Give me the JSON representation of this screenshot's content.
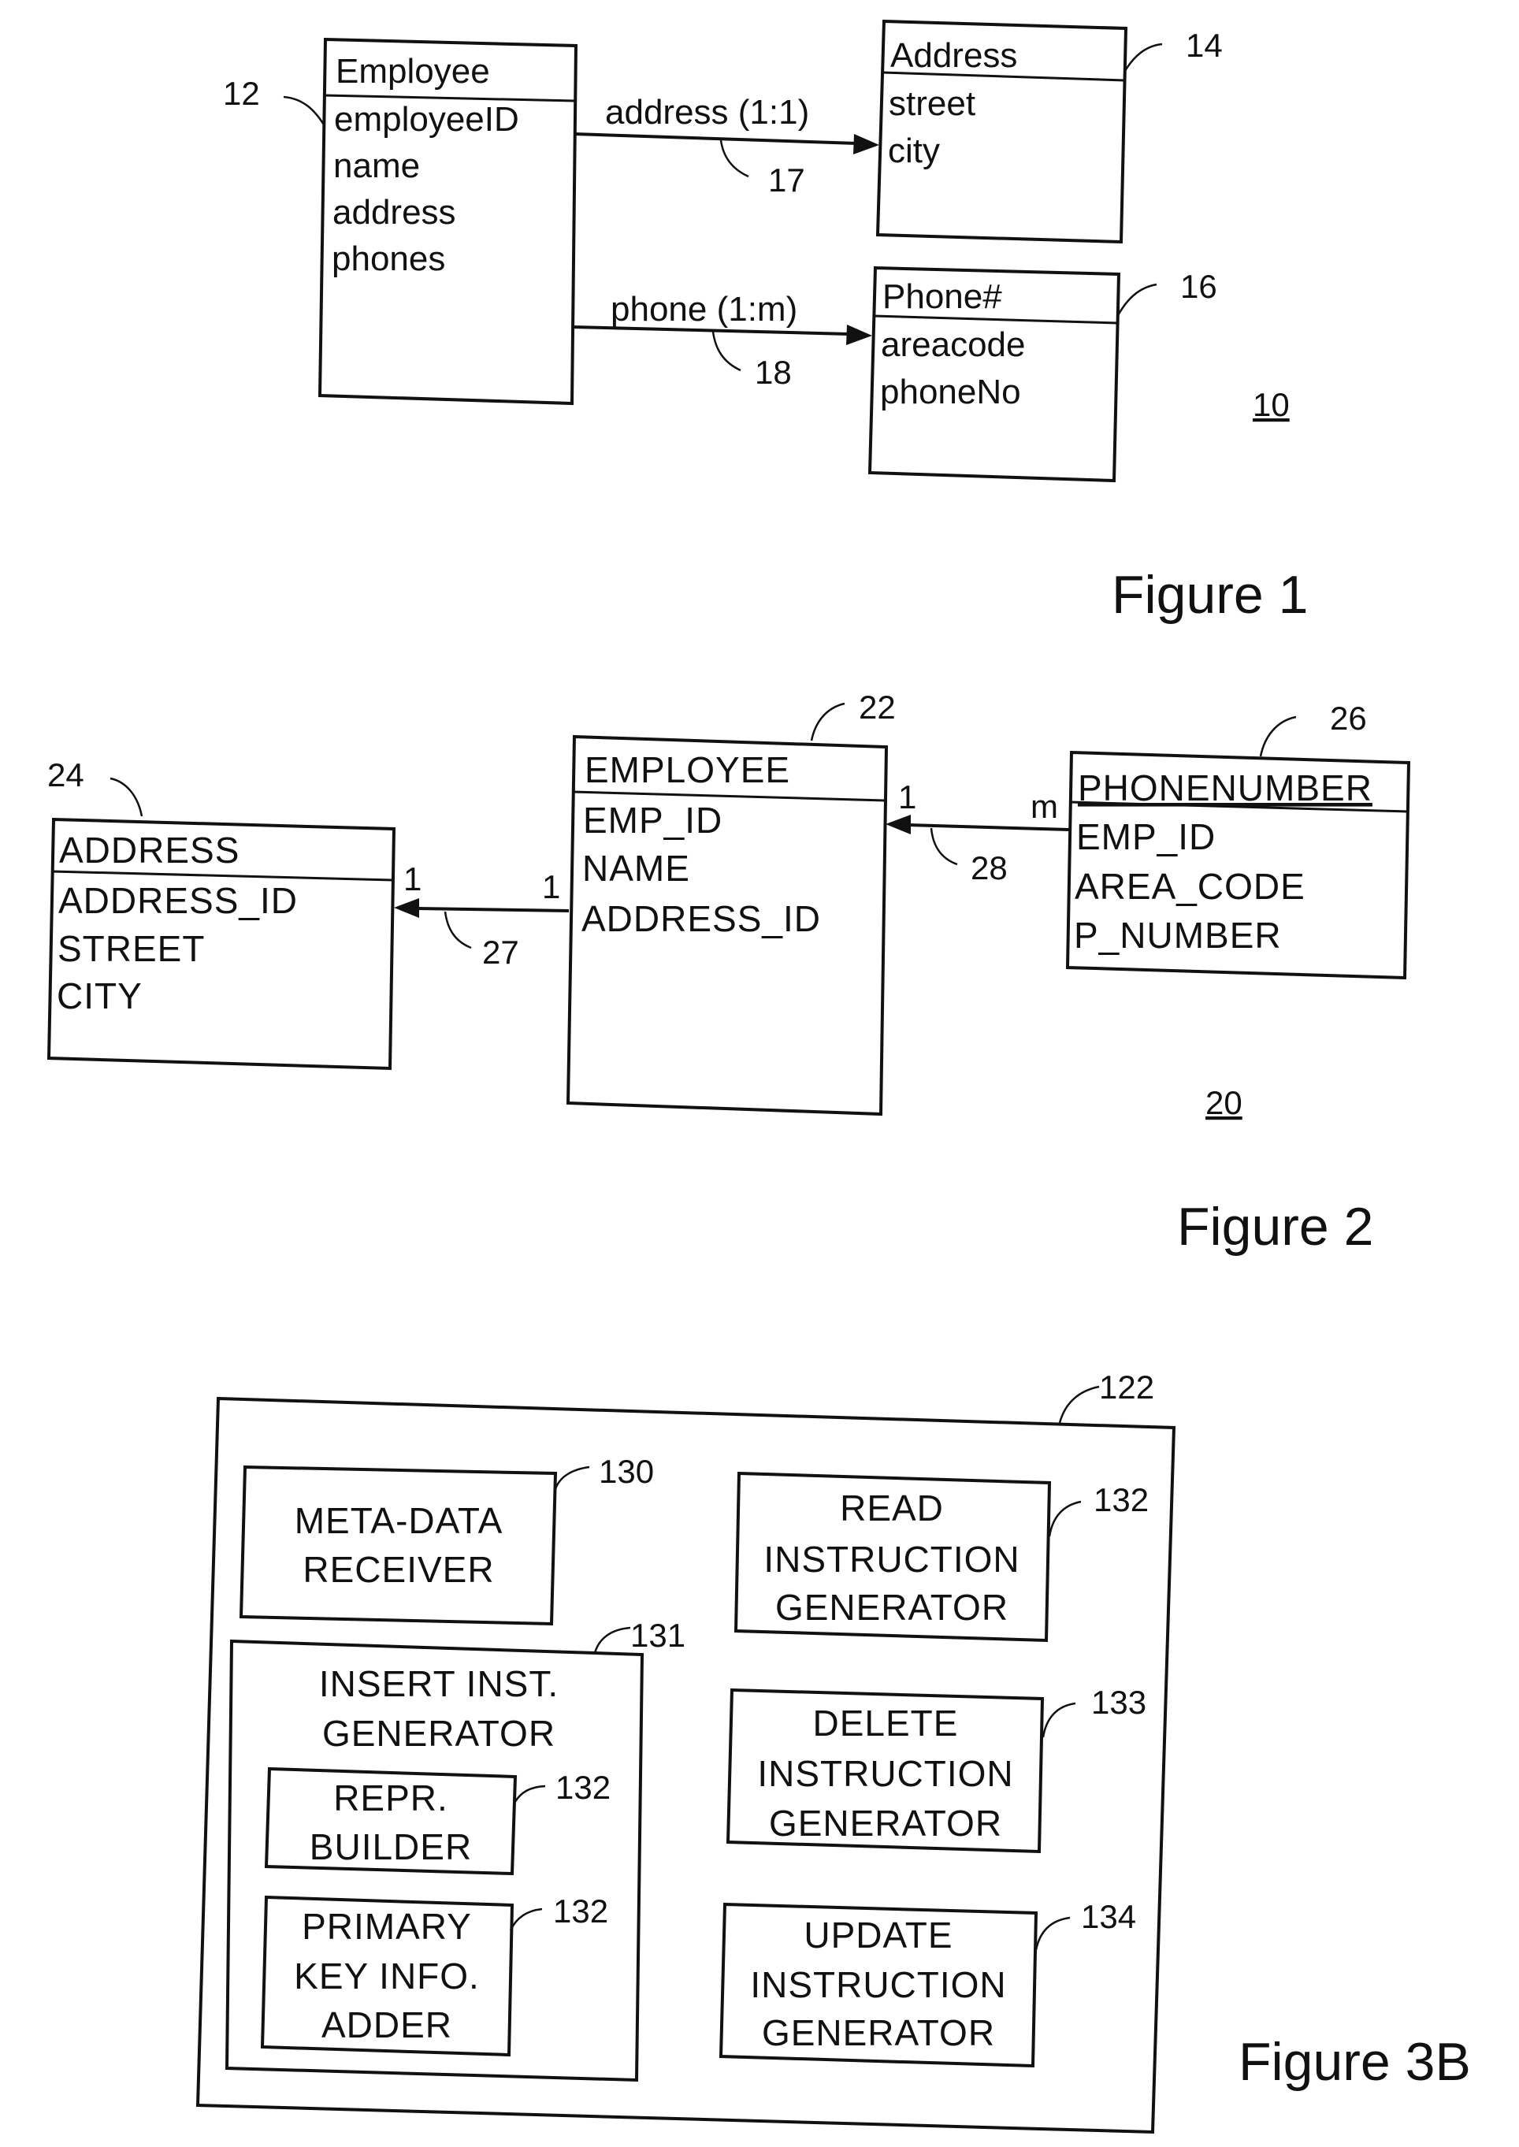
{
  "figure1": {
    "caption": "Figure 1",
    "diagram_ref": "10",
    "entities": {
      "employee": {
        "ref": "12",
        "title": "Employee",
        "fields": [
          "employeeID",
          "name",
          "address",
          "phones"
        ]
      },
      "address": {
        "ref": "14",
        "title": "Address",
        "fields": [
          "street",
          "city"
        ]
      },
      "phone": {
        "ref": "16",
        "title": "Phone#",
        "fields": [
          "areacode",
          "phoneNo"
        ]
      }
    },
    "relations": {
      "address": {
        "label": "address (1:1)",
        "ref": "17"
      },
      "phone": {
        "label": "phone (1:m)",
        "ref": "18"
      }
    }
  },
  "figure2": {
    "caption": "Figure 2",
    "diagram_ref": "20",
    "tables": {
      "address": {
        "ref": "24",
        "title": "ADDRESS",
        "columns": [
          "ADDRESS_ID",
          "STREET",
          "CITY"
        ]
      },
      "employee": {
        "ref": "22",
        "title": "EMPLOYEE",
        "columns": [
          "EMP_ID",
          "NAME",
          "ADDRESS_ID"
        ]
      },
      "phonenumber": {
        "ref": "26",
        "title": "PHONENUMBER",
        "columns": [
          "EMP_ID",
          "AREA_CODE",
          "P_NUMBER"
        ]
      }
    },
    "relations": {
      "employee_address": {
        "ref": "27",
        "source_cardinality": "1",
        "target_cardinality": "1"
      },
      "phonenumber_employee": {
        "ref": "28",
        "source_cardinality": "m",
        "target_cardinality": "1"
      }
    }
  },
  "figure3b": {
    "caption": "Figure 3B",
    "container_ref": "122",
    "modules": {
      "metadata_receiver": {
        "ref": "130",
        "lines": [
          "META-DATA",
          "RECEIVER"
        ]
      },
      "insert_generator": {
        "ref": "131",
        "lines": [
          "INSERT INST.",
          "GENERATOR"
        ]
      },
      "repr_builder": {
        "ref": "132",
        "lines": [
          "REPR.",
          "BUILDER"
        ]
      },
      "primary_key_adder": {
        "ref": "132",
        "lines": [
          "PRIMARY",
          "KEY INFO.",
          "ADDER"
        ]
      },
      "read_generator": {
        "ref": "132",
        "lines": [
          "READ",
          "INSTRUCTION",
          "GENERATOR"
        ]
      },
      "delete_generator": {
        "ref": "133",
        "lines": [
          "DELETE",
          "INSTRUCTION",
          "GENERATOR"
        ]
      },
      "update_generator": {
        "ref": "134",
        "lines": [
          "UPDATE",
          "INSTRUCTION",
          "GENERATOR"
        ]
      }
    }
  }
}
